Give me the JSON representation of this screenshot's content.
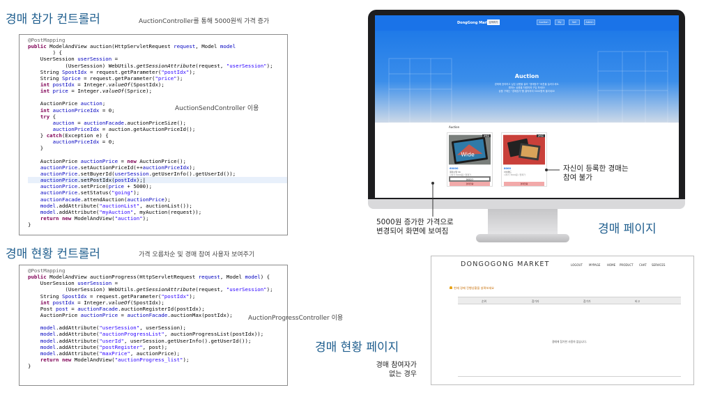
{
  "top_section": {
    "title": "경매 참가 컨트롤러",
    "subtitle": "AuctionController를 통해 5000원씩 가격 증가",
    "note": "AuctionSendController 이용"
  },
  "bottom_section": {
    "title": "경매 현황 컨트롤러",
    "subtitle": "가격 오름차순 및 경매 참여 사용자 보여주기",
    "note": "AuctionProgressController 이용"
  },
  "auction_page": {
    "nav": {
      "brand": "DongGong Market",
      "search": "검색하기",
      "buttons": [
        "Auction",
        "My",
        "Sell",
        "Admin"
      ]
    },
    "hero": {
      "title": "Auction",
      "lines": [
        "경매에 참여하고 싶은 상품을 골라 \"경매참가\" 버튼을 눌러주세요.",
        "원하는 상품을 저렴하게 구입 하세요!",
        "상품 구매는 \"경매참가\"를 클릭하여 5000원씩 올리세요!"
      ]
    },
    "section_label": "Auction",
    "cards": [
      {
        "tag": "경매중",
        "price": "60000",
        "t1": "갤럭시탭 S6",
        "t2": "시작가 5000원 / 현재가",
        "btn1": "경매참가",
        "btn2": "경매현황"
      },
      {
        "tag": "경매중",
        "price": "8000",
        "t1": "아이패드",
        "t2": "시작가 3000원 / 현재가",
        "btn1": "경매현황"
      }
    ]
  },
  "callouts": {
    "own_item": "자신이 등록한 경매는\n참여 불가",
    "price_up": "5000원 증가한 가격으로\n변경되어 화면에 보여짐",
    "auction_page_label": "경매 페이지",
    "status_page_label": "경매 현황 페이지",
    "no_participants": "경매 참여자가\n없는 경우"
  },
  "status_page": {
    "brand": "DONGOGONG MARKET",
    "menu": [
      "LOGOUT",
      "MYPAGE",
      "HOME",
      "PRODUCT",
      "CHAT",
      "SERVICES"
    ],
    "notice": "현재 경매 진행상황을 살펴보세요",
    "columns": [
      "순위",
      "참가자",
      "참가가",
      "비고"
    ],
    "empty": "경매에 참가한 사용자 없습니다."
  },
  "colors": {
    "accent": "#1f5e8e",
    "nav_blue": "#1a73e8",
    "code_keyword": "#7f0055",
    "code_string": "#2a00ff",
    "code_field": "#0000c0"
  }
}
